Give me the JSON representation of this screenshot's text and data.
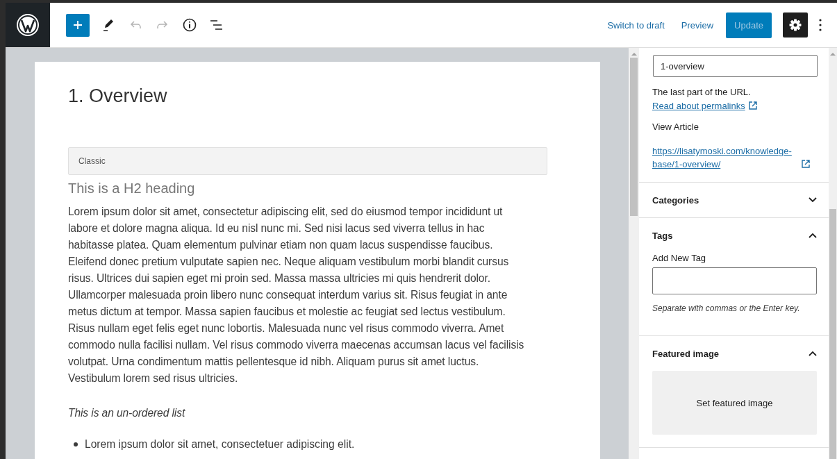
{
  "toolbar": {
    "tools": [
      {
        "kind": "add"
      },
      {
        "kind": "edit"
      },
      {
        "kind": "undo",
        "disabled": true
      },
      {
        "kind": "redo",
        "disabled": true
      },
      {
        "kind": "info"
      },
      {
        "kind": "outline"
      }
    ],
    "actions": [
      {
        "label": "Switch to draft"
      },
      {
        "label": "Preview"
      }
    ],
    "update_button": {
      "label": "Update",
      "disabled": true
    },
    "settings_selected": true
  },
  "editor": {
    "title": "1. Overview",
    "classic_block": {
      "label": "Classic"
    },
    "heading": "This is a H2 heading",
    "paragraph": "Lorem ipsum dolor sit amet, consectetur adipiscing elit, sed do eiusmod tempor incididunt ut labore et dolore magna aliqua. Id eu nisl nunc mi. Sed nisi lacus sed viverra tellus in hac habitasse platea. Quam elementum pulvinar etiam non quam lacus suspendisse faucibus. Eleifend donec pretium vulputate sapien nec. Neque aliquam vestibulum morbi blandit cursus risus. Ultrices dui sapien eget mi proin sed. Massa massa ultricies mi quis hendrerit dolor. Ullamcorper malesuada proin libero nunc consequat interdum varius sit. Risus feugiat in ante metus dictum at tempor. Massa sapien faucibus et molestie ac feugiat sed lectus vestibulum. Risus nullam eget felis eget nunc lobortis. Malesuada nunc vel risus commodo viverra. Amet commodo nulla facilisi nullam. Vel risus commodo viverra maecenas accumsan lacus vel facilisis volutpat. Urna condimentum mattis pellentesque id nibh. Aliquam purus sit amet luctus. Vestibulum lorem sed risus ultricies.",
    "list_caption": "This is an un-ordered list",
    "list_items": [
      "Lorem ipsum dolor sit amet, consectetuer adipiscing elit."
    ]
  },
  "sidebar": {
    "slug_value": "1-overview",
    "slug_help": "The last part of the URL.",
    "slug_help_link": "Read about permalinks",
    "view_label": "View Article",
    "view_link": "https://lisatymoski.com/knowledge-base/1-overview/",
    "panels": [
      {
        "kind": "categories",
        "title": "Categories",
        "expanded": false
      },
      {
        "kind": "tags",
        "title": "Tags",
        "expanded": true,
        "field_label": "Add New Tag",
        "hint": "Separate with commas or the Enter key."
      },
      {
        "kind": "featured",
        "title": "Featured image",
        "expanded": true,
        "button": "Set featured image"
      }
    ]
  }
}
